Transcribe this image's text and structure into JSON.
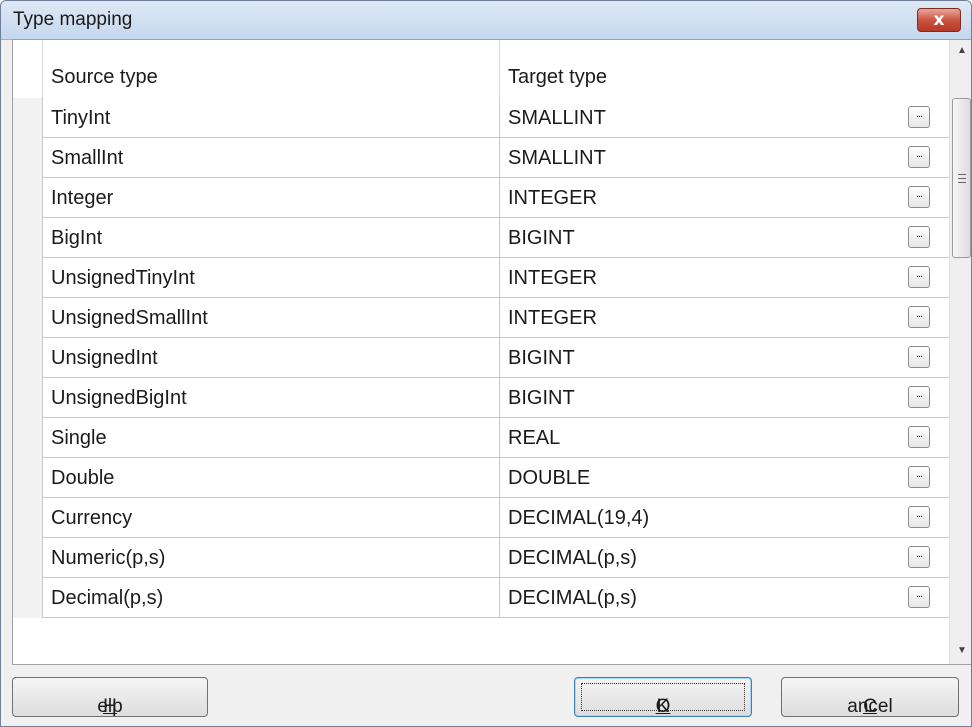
{
  "window": {
    "title": "Type mapping",
    "close_label": "x"
  },
  "grid": {
    "columns": [
      "Source type",
      "Target type"
    ],
    "rows": [
      {
        "source": "TinyInt",
        "target": "SMALLINT"
      },
      {
        "source": "SmallInt",
        "target": "SMALLINT"
      },
      {
        "source": "Integer",
        "target": "INTEGER"
      },
      {
        "source": "BigInt",
        "target": "BIGINT"
      },
      {
        "source": "UnsignedTinyInt",
        "target": "INTEGER"
      },
      {
        "source": "UnsignedSmallInt",
        "target": "INTEGER"
      },
      {
        "source": "UnsignedInt",
        "target": "BIGINT"
      },
      {
        "source": "UnsignedBigInt",
        "target": "BIGINT"
      },
      {
        "source": "Single",
        "target": "REAL"
      },
      {
        "source": "Double",
        "target": "DOUBLE"
      },
      {
        "source": "Currency",
        "target": "DECIMAL(19,4)"
      },
      {
        "source": "Numeric(p,s)",
        "target": "DECIMAL(p,s)"
      },
      {
        "source": "Decimal(p,s)",
        "target": "DECIMAL(p,s)"
      }
    ],
    "ellipsis_label": "...",
    "scroll": {
      "up_icon": "▲",
      "down_icon": "▼"
    }
  },
  "buttons": {
    "help": {
      "mnemonic": "H",
      "rest": "elp"
    },
    "ok": {
      "mnemonic": "O",
      "rest": "K"
    },
    "cancel": {
      "mnemonic": "C",
      "rest": "ancel"
    }
  }
}
